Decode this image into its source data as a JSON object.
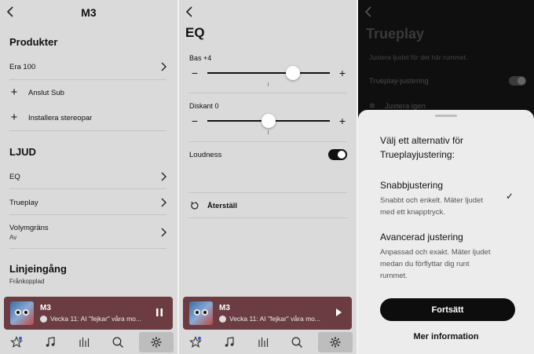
{
  "settings": {
    "title": "M3",
    "products_heading": "Produkter",
    "products": [
      {
        "label": "Era 100"
      },
      {
        "label": "Anslut Sub"
      },
      {
        "label": "Installera stereopar"
      }
    ],
    "sound_heading": "LJUD",
    "sound_items": [
      {
        "label": "EQ"
      },
      {
        "label": "Trueplay"
      },
      {
        "label": "Volymgräns",
        "sub": "Av"
      }
    ],
    "line_in_heading": "Linjeingång",
    "line_in_status": "Frånkopplad"
  },
  "eq": {
    "title": "EQ",
    "bass_label": "Bas +4",
    "bass_value": 4,
    "treble_label": "Diskant 0",
    "treble_value": 0,
    "slider_range": [
      -10,
      10
    ],
    "loudness_label": "Loudness",
    "loudness_on": true,
    "reset_label": "Återställ"
  },
  "trueplay": {
    "title": "Trueplay",
    "subtitle": "Justera ljudet för det här rummet.",
    "toggle_label": "Trueplay-justering",
    "toggle_on": true,
    "retune_label": "Justera igen",
    "sheet": {
      "question": "Välj ett alternativ för Trueplayjustering:",
      "option1_title": "Snabbjustering",
      "option1_desc": "Snabbt och enkelt. Mäter ljudet med ett knapptryck.",
      "option1_selected": true,
      "option2_title": "Avancerad justering",
      "option2_desc": "Anpassad och exakt. Mäter ljudet medan du förflyttar dig runt rummet.",
      "continue_label": "Fortsätt",
      "more_label": "Mer information"
    }
  },
  "player": {
    "title": "M3",
    "subtitle": "Vecka 11: AI \"fejkar\" våra mo...",
    "color": "#6b3c41"
  },
  "tabs": [
    {
      "icon": "star-icon"
    },
    {
      "icon": "music-note-icon"
    },
    {
      "icon": "bars-icon"
    },
    {
      "icon": "search-icon"
    },
    {
      "icon": "gear-icon"
    }
  ]
}
